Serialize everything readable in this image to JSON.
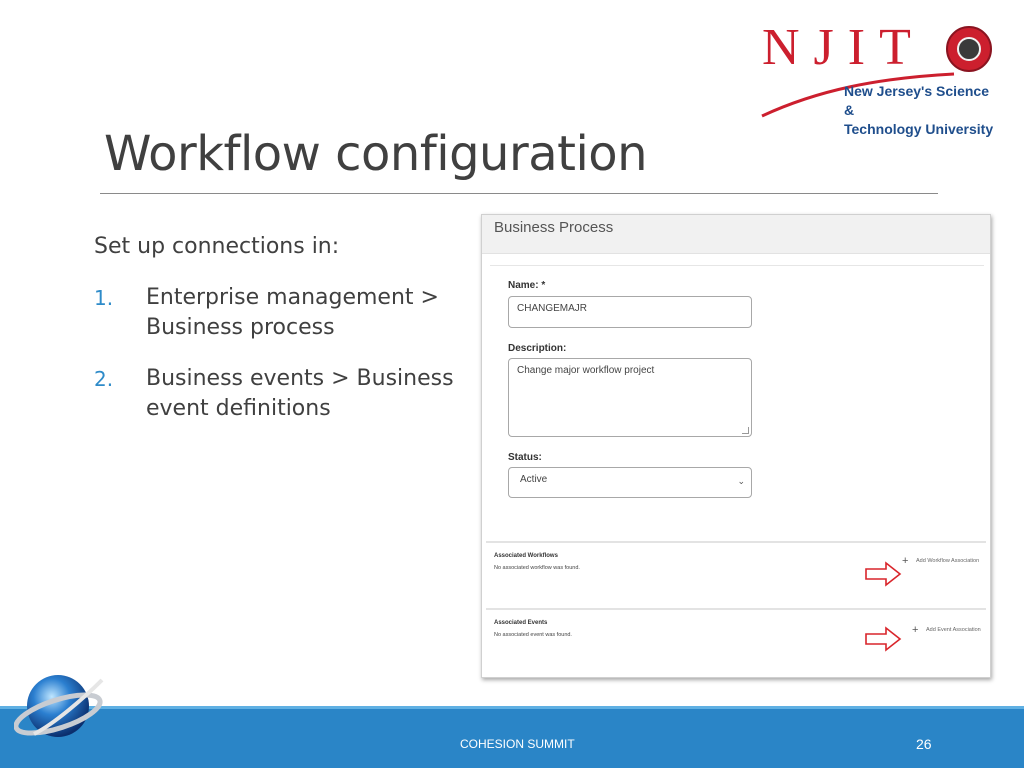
{
  "logo": {
    "letters": "NJIT",
    "tagline_line1": "New Jersey's Science &",
    "tagline_line2": "Technology University"
  },
  "slide": {
    "title": "Workflow configuration",
    "intro": "Set up connections in:",
    "steps": [
      {
        "num": "1.",
        "text": "Enterprise management > Business process"
      },
      {
        "num": "2.",
        "text": "Business events > Business event definitions"
      }
    ]
  },
  "screenshot": {
    "header_title": "Business Process",
    "name_label": "Name: *",
    "name_value": "CHANGEMAJR",
    "description_label": "Description:",
    "description_value": "Change major workflow project",
    "status_label": "Status:",
    "status_value": "Active",
    "workflows": {
      "title": "Associated Workflows",
      "message": "No associated workflow was found.",
      "add_label": "Add Workflow Association"
    },
    "events": {
      "title": "Associated Events",
      "message": "No associated event was found.",
      "add_label": "Add Event Association"
    }
  },
  "footer": {
    "text": "COHESION SUMMIT",
    "page_number": "26"
  },
  "colors": {
    "accent_blue": "#2a85c7",
    "njit_red": "#cc1f2e",
    "arrow_red": "#d9252b",
    "number_blue": "#2e8bc9"
  },
  "icons": [
    "plus-icon",
    "right-arrow-icon",
    "chevron-down-icon",
    "globe-logo-icon"
  ]
}
